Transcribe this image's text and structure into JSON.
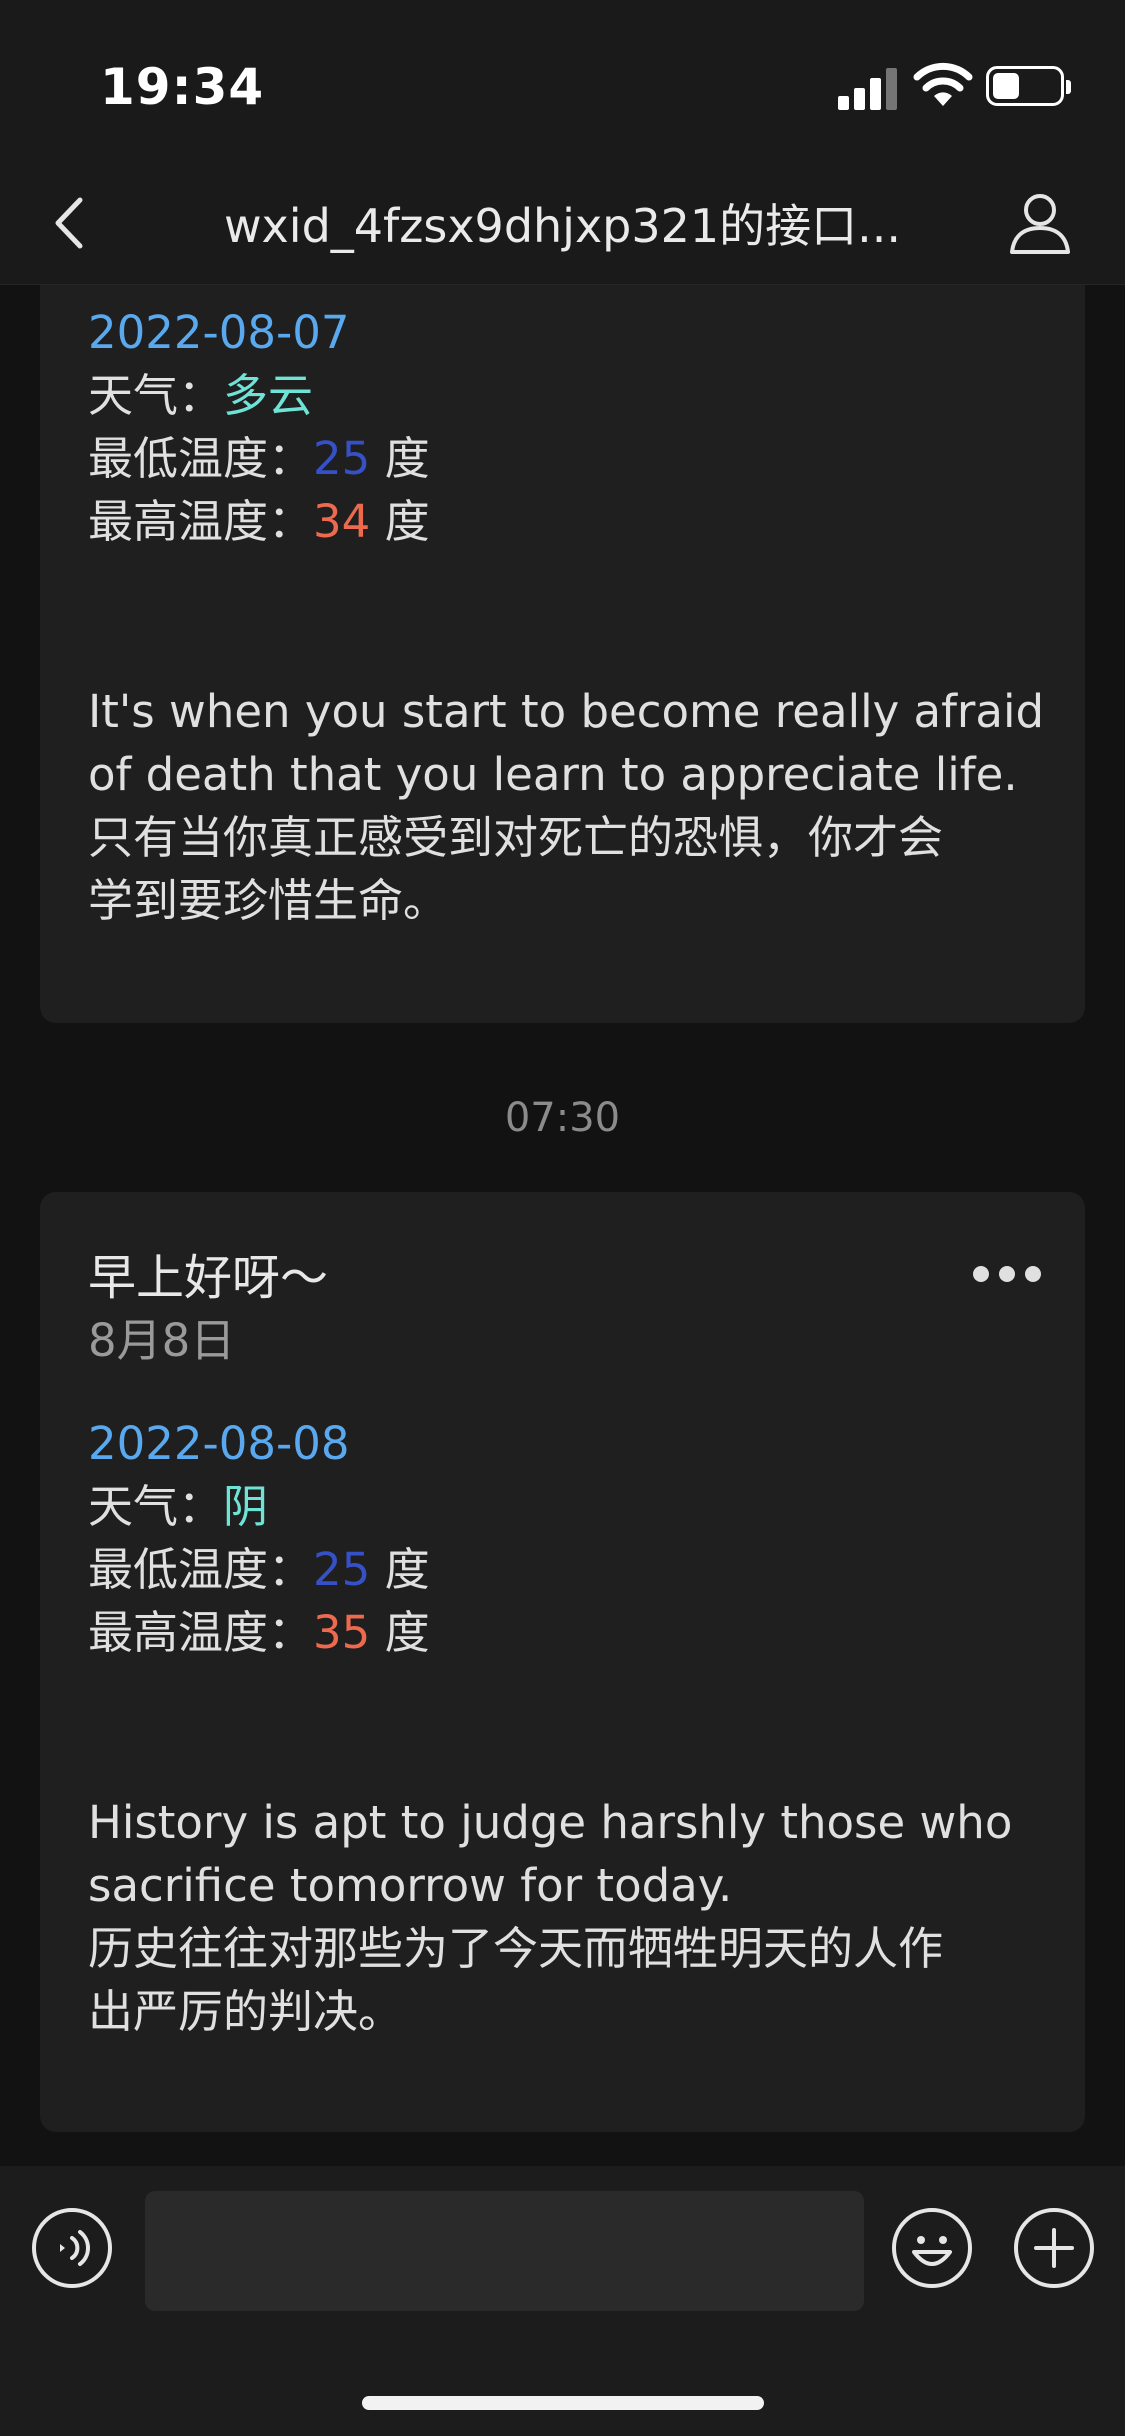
{
  "status": {
    "time": "19:34"
  },
  "nav": {
    "title": "wxid_4fzsx9dhjxp321的接口..."
  },
  "card1": {
    "date": "2022-08-07",
    "weather_label": "天气：",
    "weather_value": "多云",
    "low_label": "最低温度：",
    "low_value": "25",
    "high_label": "最高温度：",
    "high_value": "34",
    "unit": " 度",
    "quote_lines": [
      "It's when you start to become really afraid",
      "of death that you learn to appreciate life.",
      "只有当你真正感受到对死亡的恐惧，你才会",
      "学到要珍惜生命。"
    ]
  },
  "timestamp": "07:30",
  "card2": {
    "greeting": "早上好呀～",
    "subdate": "8月8日",
    "date": "2022-08-08",
    "weather_label": "天气：",
    "weather_value": "阴",
    "low_label": "最低温度：",
    "low_value": "25",
    "high_label": "最高温度：",
    "high_value": "35",
    "unit": " 度",
    "quote_lines": [
      "History is apt to judge harshly those who",
      "sacrifice tomorrow for today.",
      "历史往往对那些为了今天而牺牲明天的人作",
      "出严厉的判决。"
    ]
  },
  "input": {
    "value": ""
  },
  "icons": {
    "back": "chevron-left-icon",
    "profile": "person-icon",
    "more": "more-dots-icon",
    "voice": "voice-icon",
    "emoji": "emoji-icon",
    "plus": "plus-icon"
  },
  "colors": {
    "date": "#5aa9ee",
    "weather": "#6fe3d6",
    "low_temp": "#3651c8",
    "high_temp": "#ee6a4e"
  }
}
